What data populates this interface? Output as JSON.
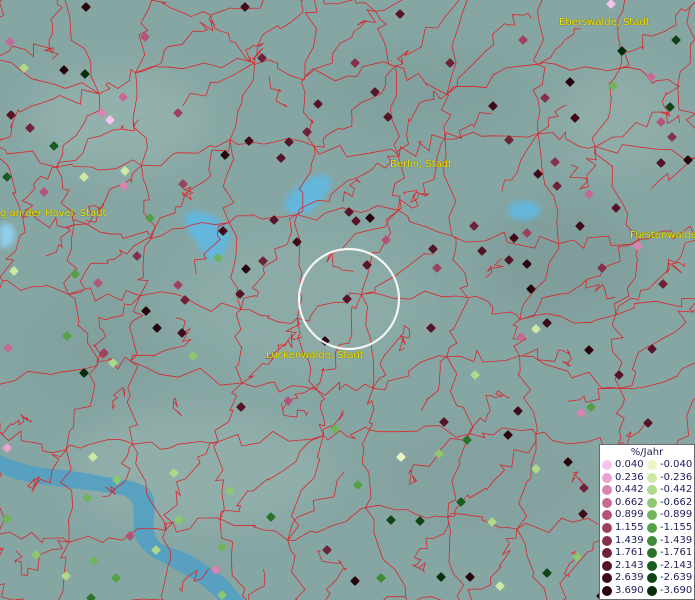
{
  "map": {
    "place_labels": [
      {
        "id": "eberswalde",
        "text": "Eberswalde, Stadt"
      },
      {
        "id": "berlin",
        "text": "Berlin, Stadt"
      },
      {
        "id": "brandenburg",
        "text": "g an der Havel, Stadt"
      },
      {
        "id": "fuerstenwalde",
        "text": "Fürstenwalde"
      },
      {
        "id": "luckenwalde",
        "text": "Luckenwalde, Stadt"
      }
    ],
    "colors": {
      "background": "#86a6a3",
      "borders": "#d8262b",
      "water": "#64b6dc",
      "label_text": "#f2e400",
      "selection_circle": "#ffffff"
    }
  },
  "legend": {
    "title": "%/Jahr",
    "positive": [
      {
        "label": "0.040",
        "color": "#f7c3ec"
      },
      {
        "label": "0.236",
        "color": "#e8a3cf"
      },
      {
        "label": "0.442",
        "color": "#d884b2"
      },
      {
        "label": "0.662",
        "color": "#c56a95"
      },
      {
        "label": "0.899",
        "color": "#b25579"
      },
      {
        "label": "1.155",
        "color": "#9c4260"
      },
      {
        "label": "1.439",
        "color": "#85314b"
      },
      {
        "label": "1.761",
        "color": "#6d2238"
      },
      {
        "label": "2.143",
        "color": "#561527"
      },
      {
        "label": "2.639",
        "color": "#3f0b18"
      },
      {
        "label": "3.690",
        "color": "#27040c"
      }
    ],
    "negative": [
      {
        "label": "-0.040",
        "color": "#eaf6c4"
      },
      {
        "label": "-0.236",
        "color": "#cde9a5"
      },
      {
        "label": "-0.442",
        "color": "#add989"
      },
      {
        "label": "-0.662",
        "color": "#8dc770"
      },
      {
        "label": "-0.899",
        "color": "#6fb45a"
      },
      {
        "label": "-1.155",
        "color": "#54a047"
      },
      {
        "label": "-1.439",
        "color": "#3e8a38"
      },
      {
        "label": "-1.761",
        "color": "#2b732b"
      },
      {
        "label": "-2.143",
        "color": "#1b5c20"
      },
      {
        "label": "-2.639",
        "color": "#0f4516"
      },
      {
        "label": "-3.690",
        "color": "#062e0c"
      }
    ]
  }
}
